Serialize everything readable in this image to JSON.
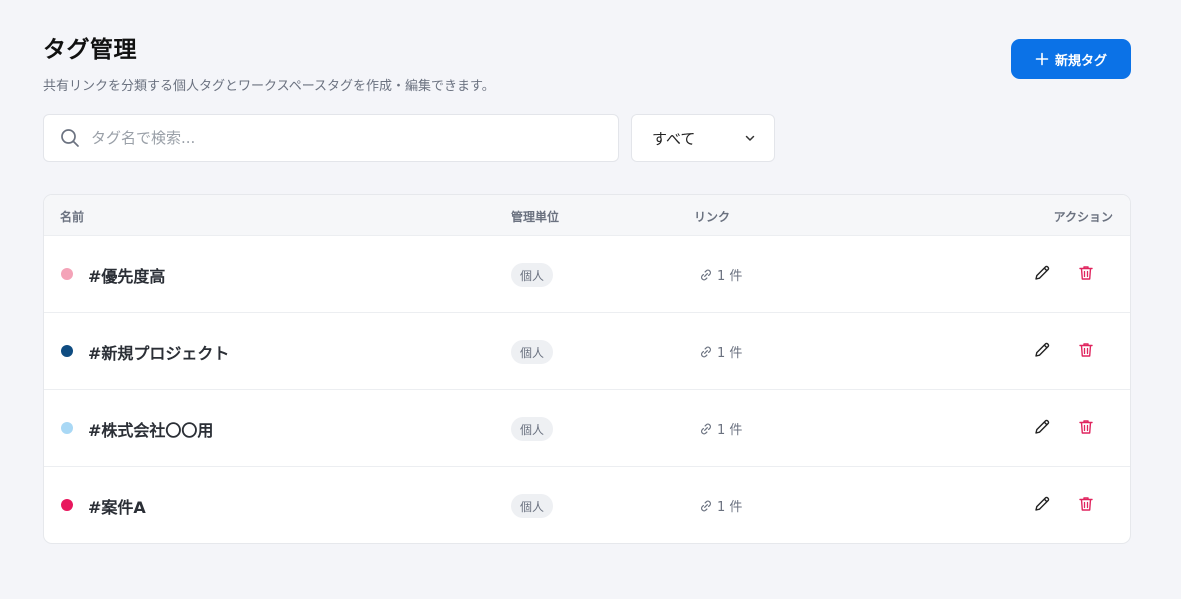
{
  "header": {
    "title": "タグ管理",
    "subtitle": "共有リンクを分類する個人タグとワークスペースタグを作成・編集できます。",
    "new_button_label": "新規タグ",
    "new_button_icon": "plus-icon"
  },
  "search": {
    "placeholder": "タグ名で検索...",
    "value": "",
    "icon": "search-icon"
  },
  "filter": {
    "selected": "すべて",
    "icon": "chevron-down-icon"
  },
  "table": {
    "columns": [
      "名前",
      "管理単位",
      "リンク",
      "アクション"
    ],
    "rows": [
      {
        "color": "#f4a3b8",
        "name": "#優先度高",
        "unit": "個人",
        "links": "1 件"
      },
      {
        "color": "#0f4c81",
        "name": "#新規プロジェクト",
        "unit": "個人",
        "links": "1 件"
      },
      {
        "color": "#a9d8f5",
        "name": "#株式会社〇〇用",
        "unit": "個人",
        "links": "1 件"
      },
      {
        "color": "#e8175d",
        "name": "#案件A",
        "unit": "個人",
        "links": "1 件"
      }
    ]
  },
  "colors": {
    "accent": "#0b72e7",
    "danger": "#e0245e",
    "background": "#f4f5f9"
  }
}
